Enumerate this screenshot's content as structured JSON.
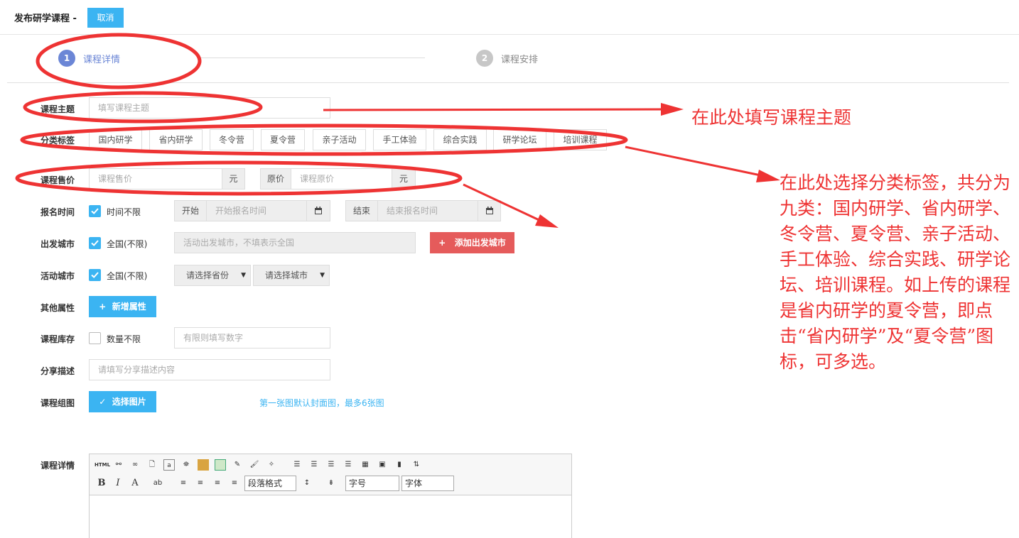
{
  "header": {
    "title": "发布研学课程 -",
    "cancel_label": "取消"
  },
  "steps": [
    {
      "number": "1",
      "label": "课程详情"
    },
    {
      "number": "2",
      "label": "课程安排"
    }
  ],
  "form": {
    "topic": {
      "label": "课程主题",
      "placeholder": "填写课程主题"
    },
    "tags": {
      "label": "分类标签",
      "items": [
        "国内研学",
        "省内研学",
        "冬令营",
        "夏令营",
        "亲子活动",
        "手工体验",
        "综合实践",
        "研学论坛",
        "培训课程"
      ]
    },
    "price": {
      "label": "课程售价",
      "placeholder": "课程售价",
      "unit": "元",
      "orig_label": "原价",
      "orig_placeholder": "课程原价",
      "orig_unit": "元"
    },
    "signup": {
      "label": "报名时间",
      "checkbox": "时间不限",
      "start_label": "开始",
      "start_placeholder": "开始报名时间",
      "end_label": "结束",
      "end_placeholder": "结束报名时间"
    },
    "depart": {
      "label": "出发城市",
      "checkbox": "全国(不限)",
      "placeholder": "活动出发城市，不填表示全国",
      "add_button": "添加出发城市"
    },
    "activity": {
      "label": "活动城市",
      "checkbox": "全国(不限)",
      "province": "请选择省份",
      "city": "请选择城市"
    },
    "other": {
      "label": "其他属性",
      "button": "新增属性"
    },
    "stock": {
      "label": "课程库存",
      "checkbox": "数量不限",
      "placeholder": "有限则填写数字"
    },
    "share": {
      "label": "分享描述",
      "placeholder": "请填写分享描述内容"
    },
    "images": {
      "label": "课程组图",
      "button": "选择图片",
      "hint": "第一张图默认封面图，最多6张图"
    },
    "detail": {
      "label": "课程详情",
      "paragraph": "段落格式",
      "font_size": "字号",
      "font_family": "字体",
      "html_icon": "HTML"
    }
  },
  "annotations": {
    "topic_note": "在此处填写课程主题",
    "tags_note": "在此处选择分类标签，共分为九类：国内研学、省内研学、冬令营、夏令营、亲子活动、手工体验、综合实践、研学论坛、培训课程。如上传的课程是省内研学的夏令营，即点击“省内研学”及“夏令营”图标，可多选。"
  },
  "colors": {
    "primary": "#3bb4f2",
    "danger": "#e55b5b",
    "annotation": "#ee3333",
    "step_active": "#6b86d6",
    "step_inactive": "#c7c7c7"
  }
}
